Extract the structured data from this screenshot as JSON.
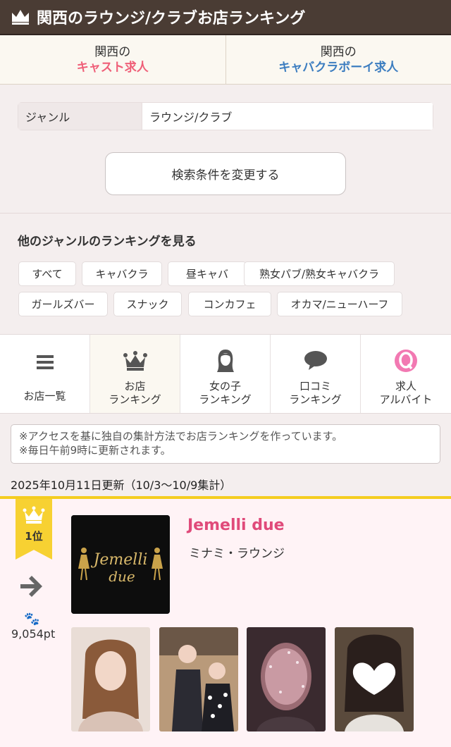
{
  "header": {
    "title": "関西のラウンジ/クラブお店ランキング"
  },
  "job_links": [
    {
      "region": "関西の",
      "label": "キャスト求人"
    },
    {
      "region": "関西の",
      "label": "キャバクラボーイ求人"
    }
  ],
  "search": {
    "genre_label": "ジャンル",
    "genre_value": "ラウンジ/クラブ",
    "change_button": "検索条件を変更する"
  },
  "other_genres": {
    "title": "他のジャンルのランキングを見る",
    "chips": [
      "すべて",
      "キャバクラ",
      "昼キャバ",
      "熟女パブ/熟女キャバクラ",
      "ガールズバー",
      "スナック",
      "コンカフェ",
      "オカマ/ニューハーフ"
    ]
  },
  "tabs": [
    {
      "label": "お店一覧",
      "icon": "list-icon"
    },
    {
      "label": "お店\nランキング",
      "icon": "crown-icon"
    },
    {
      "label": "女の子\nランキング",
      "icon": "girl-icon"
    },
    {
      "label": "口コミ\nランキング",
      "icon": "speech-bubble-icon"
    },
    {
      "label": "求人\nアルバイト",
      "icon": "job-icon"
    }
  ],
  "notice": {
    "line1": "※アクセスを基に独自の集計方法でお店ランキングを作っています。",
    "line2": "※毎日午前9時に更新されます。"
  },
  "updated": "2025年10月11日更新（10/3〜10/9集計）",
  "ranking": [
    {
      "rank": "1位",
      "trend_icon": "arrow-right-icon",
      "points": "9,054pt",
      "name": "Jemelli due",
      "area_genre": "ミナミ・ラウンジ",
      "logo_text_1": "Jemelli",
      "logo_text_2": "due"
    }
  ],
  "colors": {
    "header_bg": "#4a3c34",
    "cast_link": "#ef5f78",
    "boy_link": "#3c7dc0",
    "shop_name": "#e04a7a",
    "rank_gold": "#f7d132"
  }
}
